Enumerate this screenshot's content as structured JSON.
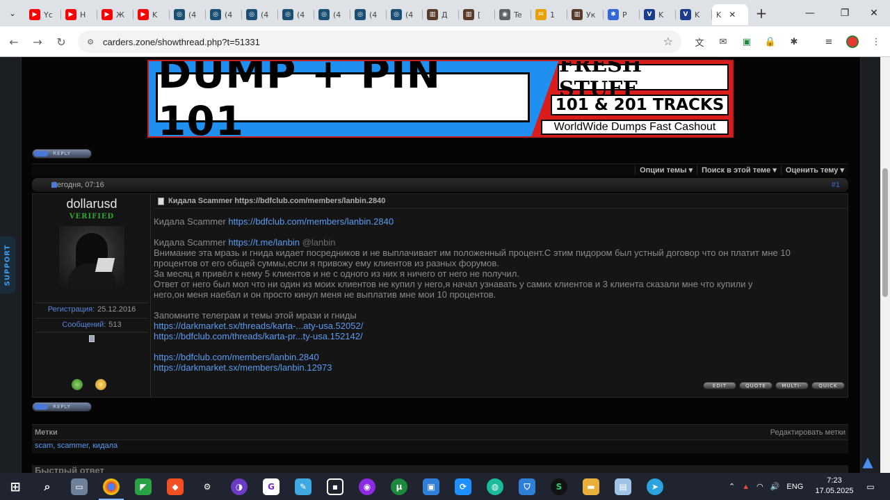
{
  "browser": {
    "tabs": [
      {
        "label": "Yc",
        "icon": "youtube-icon",
        "color": "#ff0000",
        "glyph": "▶"
      },
      {
        "label": "H",
        "icon": "youtube-icon",
        "color": "#ff0000",
        "glyph": "▶"
      },
      {
        "label": "Ж",
        "icon": "youtube-icon",
        "color": "#ff0000",
        "glyph": "▶"
      },
      {
        "label": "K",
        "icon": "youtube-icon",
        "color": "#ff0000",
        "glyph": "▶"
      },
      {
        "label": "(4",
        "icon": "spiral-icon",
        "color": "#1c4f74",
        "glyph": "◎"
      },
      {
        "label": "(4",
        "icon": "spiral-icon",
        "color": "#1c4f74",
        "glyph": "◎"
      },
      {
        "label": "(4",
        "icon": "spiral-icon",
        "color": "#1c4f74",
        "glyph": "◎"
      },
      {
        "label": "(4",
        "icon": "spiral-icon",
        "color": "#1c4f74",
        "glyph": "◎"
      },
      {
        "label": "(4",
        "icon": "spiral-icon",
        "color": "#1c4f74",
        "glyph": "◎"
      },
      {
        "label": "(4",
        "icon": "spiral-icon",
        "color": "#1c4f74",
        "glyph": "◎"
      },
      {
        "label": "(4",
        "icon": "spiral-icon",
        "color": "#1c4f74",
        "glyph": "◎"
      },
      {
        "label": "Д",
        "icon": "forum-icon",
        "color": "#5a3a2a",
        "glyph": "▥"
      },
      {
        "label": "[",
        "icon": "forum-icon",
        "color": "#5a3a2a",
        "glyph": "▥"
      },
      {
        "label": "Te",
        "icon": "globe-icon",
        "color": "#5f6368",
        "glyph": "◉"
      },
      {
        "label": "1",
        "icon": "mail-icon",
        "color": "#e6a100",
        "glyph": "✉"
      },
      {
        "label": "Ук",
        "icon": "forum-icon",
        "color": "#5a3a2a",
        "glyph": "▥"
      },
      {
        "label": "P",
        "icon": "puzzle-icon",
        "color": "#3367d6",
        "glyph": "✱"
      },
      {
        "label": "K",
        "icon": "verified-v-icon",
        "color": "#1a3c8c",
        "glyph": "V"
      },
      {
        "label": "K",
        "icon": "verified-v-icon",
        "color": "#1a3c8c",
        "glyph": "V"
      },
      {
        "label": "K",
        "icon": "",
        "color": "#ffffff",
        "glyph": ""
      }
    ],
    "url": "carders.zone/showthread.php?t=51331"
  },
  "banner": {
    "left_text": "DUMP + PIN 101",
    "fresh": "FRESH STUFF",
    "tracks": "101 & 201 TRACKS",
    "worldwide": "WorldWide Dumps Fast Cashout"
  },
  "reply_label": "REPLY",
  "thread_tools": [
    "Опции темы",
    "Поиск в этой теме",
    "Оценить тему"
  ],
  "post": {
    "date": "Сегодня, 07:16",
    "number": "#1",
    "username": "dollarusd",
    "user_title": "VERIFIED",
    "registration_label": "Регистрация:",
    "registration_value": "25.12.2016",
    "messages_label": "Сообщений:",
    "messages_value": "513",
    "title": "Кидала Scammer https://bdfclub.com/members/lanbin.2840",
    "line1_prefix": "Кидала Scammer ",
    "line1_link": "https://bdfclub.com/members/lanbin.2840",
    "line2_prefix": "Кидала Scammer ",
    "line2_link": "https://t.me/lanbin",
    "line2_mention": "@lanbin",
    "paragraph": [
      "Внимание эта мразь и гнида кидает посредников и не выплачивает им положенный процент.С этим пидором был устный договор что он платит мне 10",
      "процентов от его общей суммы,если я привожу ему клиентов из разных форумов.",
      "За месяц я привёл к нему 5 клиентов и не с одного из них я ничего от него не получил.",
      "Ответ от него был мол что ни один из моих клиентов не купил у него,я начал узнавать у самих клиентов и 3 клиента сказали мне что купили у",
      "него,он меня наебал и он просто кинул меня не выплатив мне мои 10 процентов."
    ],
    "remember": "Запомните телеграм и темы этой мрази и гниды",
    "links_a": [
      "https://darkmarket.sx/threads/karta-...aty-usa.52052/",
      "https://bdfclub.com/threads/karta-pr...ty-usa.152142/"
    ],
    "links_b": [
      "https://bdfclub.com/members/lanbin.2840",
      "https://darkmarket.sx/members/lanbin.12973"
    ],
    "buttons": [
      "EDIT",
      "QUOTE",
      "MULTI-",
      "QUICK"
    ]
  },
  "tags": {
    "title": "Метки",
    "edit": "Редактировать метки",
    "values": "scam, scammer, кидала"
  },
  "quick_reply": "Быстрый ответ",
  "support": "SUPPORT",
  "taskbar": {
    "language": "ENG",
    "time": "7:23",
    "date": "17.05.2025"
  }
}
